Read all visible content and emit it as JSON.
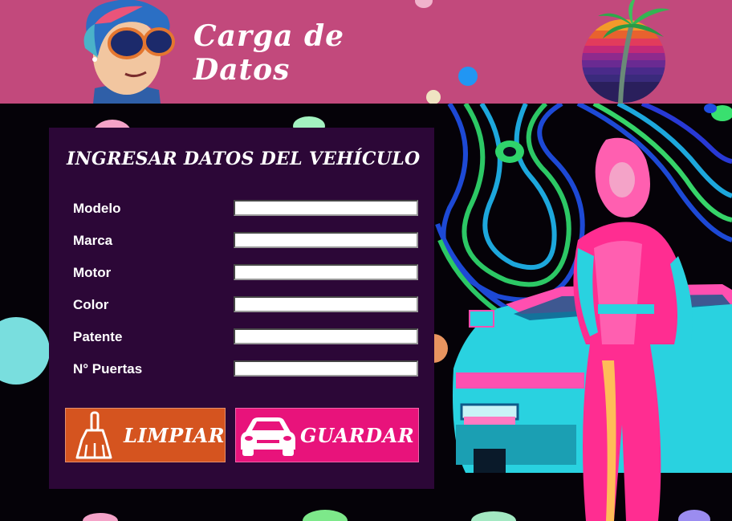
{
  "header": {
    "title": "Carga de\nDatos"
  },
  "icons": {
    "avatar": "cartoon-avatar-with-sunglasses",
    "logo": "retro-sunset-palm-logo",
    "clear": "dustpan-icon",
    "save": "car-icon"
  },
  "form": {
    "title": "INGRESAR DATOS DEL VEHÍCULO",
    "fields": [
      {
        "label": "Modelo",
        "value": ""
      },
      {
        "label": "Marca",
        "value": ""
      },
      {
        "label": "Motor",
        "value": ""
      },
      {
        "label": "Color",
        "value": ""
      },
      {
        "label": "Patente",
        "value": ""
      },
      {
        "label": "N° Puertas",
        "value": ""
      }
    ],
    "buttons": {
      "clear_label": "LIMPIAR",
      "save_label": "GUARDAR"
    }
  },
  "colors": {
    "header_bg": "#c2497c",
    "panel_bg": "#2c0737",
    "clear_button": "#d5541f",
    "save_button": "#e8137b"
  }
}
